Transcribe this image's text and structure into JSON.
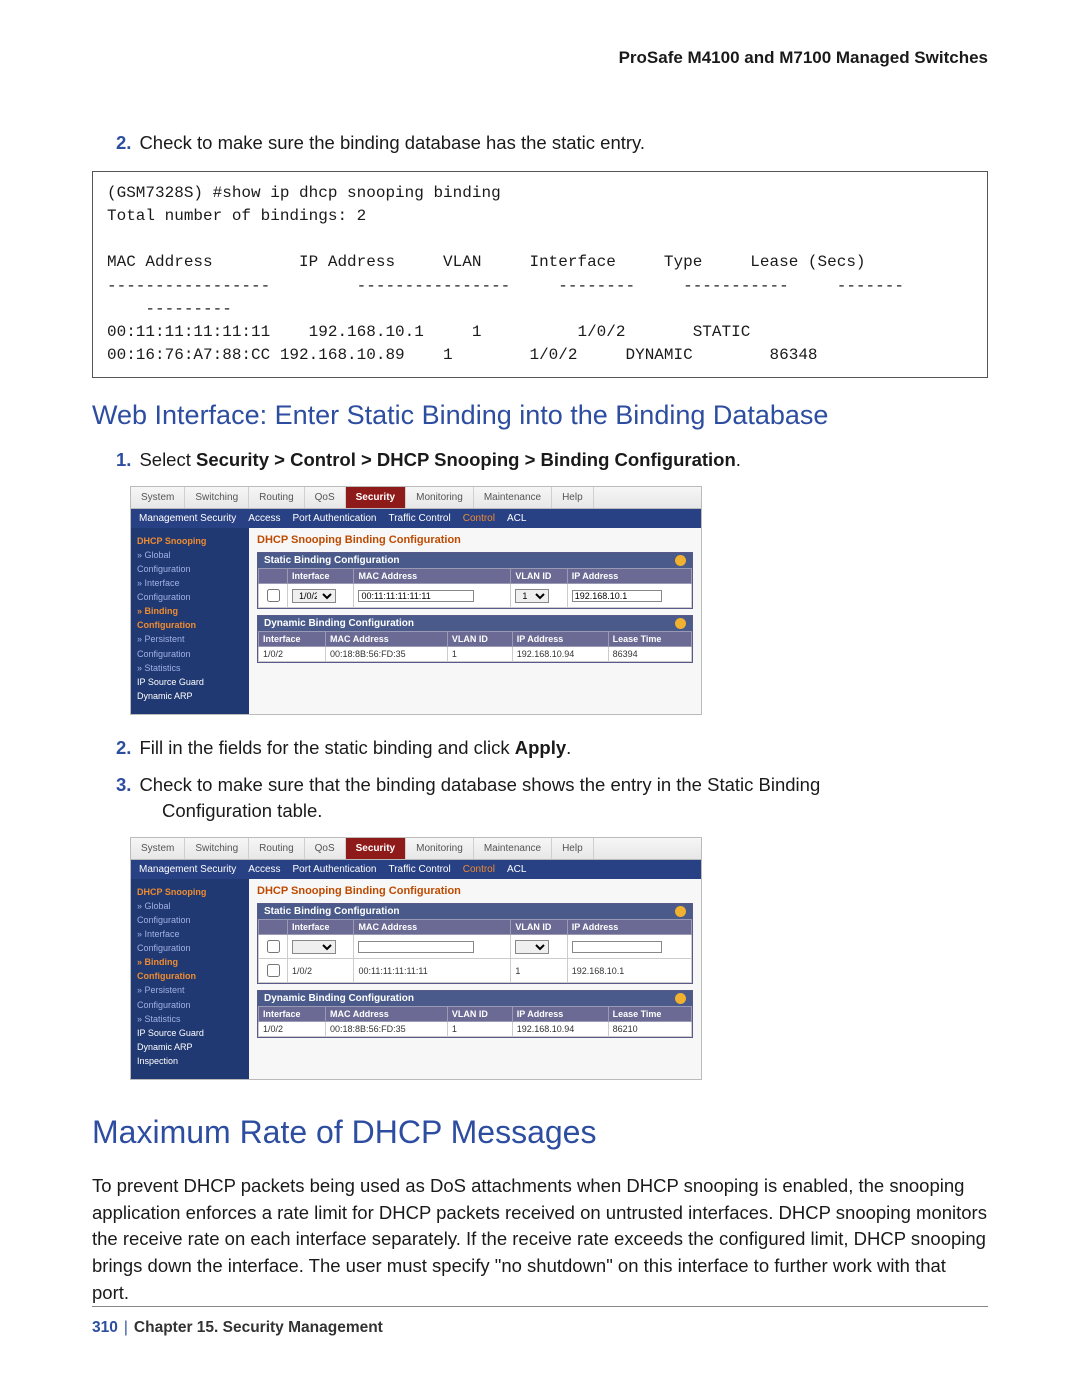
{
  "header": {
    "product_line": "ProSafe M4100 and M7100 Managed Switches"
  },
  "step2": {
    "num": "2.",
    "text": "Check to make sure the binding database has the static entry."
  },
  "code_block": "(GSM7328S) #show ip dhcp snooping binding\nTotal number of bindings: 2\n\nMAC Address         IP Address     VLAN     Interface     Type     Lease (Secs)\n-----------------         ----------------     --------     -----------     -------\n    ---------\n00:11:11:11:11:11    192.168.10.1     1          1/0/2       STATIC\n00:16:76:A7:88:CC 192.168.10.89    1        1/0/2     DYNAMIC        86348",
  "h3_web": "Web Interface: Enter Static Binding into the Binding Database",
  "step1b": {
    "num": "1.",
    "pre": "Select ",
    "bold": "Security > Control > DHCP Snooping > Binding Configuration",
    "post": "."
  },
  "ui": {
    "tabs": [
      "System",
      "Switching",
      "Routing",
      "QoS",
      "Security",
      "Monitoring",
      "Maintenance",
      "Help"
    ],
    "active_tab": "Security",
    "subnav": [
      "Management Security",
      "Access",
      "Port Authentication",
      "Traffic Control",
      "Control",
      "ACL"
    ],
    "subnav_active": "Control",
    "side1": {
      "items": [
        {
          "t": "DHCP Snooping",
          "cls": "hl"
        },
        {
          "t": "» Global",
          "cls": "dim"
        },
        {
          "t": "  Configuration",
          "cls": "dim"
        },
        {
          "t": "» Interface",
          "cls": "dim"
        },
        {
          "t": "  Configuration",
          "cls": "dim"
        },
        {
          "t": "» Binding",
          "cls": "hl"
        },
        {
          "t": "  Configuration",
          "cls": "hl"
        },
        {
          "t": "» Persistent",
          "cls": "dim"
        },
        {
          "t": "  Configuration",
          "cls": "dim"
        },
        {
          "t": "» Statistics",
          "cls": "dim"
        },
        {
          "t": "IP Source Guard",
          "cls": ""
        },
        {
          "t": "Dynamic ARP",
          "cls": ""
        }
      ]
    },
    "side2": {
      "items": [
        {
          "t": "DHCP Snooping",
          "cls": "hl"
        },
        {
          "t": "» Global",
          "cls": "dim"
        },
        {
          "t": "  Configuration",
          "cls": "dim"
        },
        {
          "t": "» Interface",
          "cls": "dim"
        },
        {
          "t": "  Configuration",
          "cls": "dim"
        },
        {
          "t": "» Binding",
          "cls": "hl"
        },
        {
          "t": "  Configuration",
          "cls": "hl"
        },
        {
          "t": "» Persistent",
          "cls": "dim"
        },
        {
          "t": "  Configuration",
          "cls": "dim"
        },
        {
          "t": "» Statistics",
          "cls": "dim"
        },
        {
          "t": "IP Source Guard",
          "cls": ""
        },
        {
          "t": "Dynamic ARP",
          "cls": ""
        },
        {
          "t": "Inspection",
          "cls": ""
        }
      ]
    },
    "main_title": "DHCP Snooping Binding Configuration",
    "sec_static": "Static Binding Configuration",
    "sec_dynamic": "Dynamic Binding Configuration",
    "static_headers": [
      "Interface",
      "MAC Address",
      "VLAN ID",
      "IP Address"
    ],
    "dynamic_headers": [
      "Interface",
      "MAC Address",
      "VLAN ID",
      "IP Address",
      "Lease Time"
    ],
    "shot1": {
      "static_row": {
        "interface": "1/0/2",
        "mac": "00:11:11:11:11:11",
        "vlan": "1",
        "ip": "192.168.10.1"
      },
      "dynamic_row": {
        "interface": "1/0/2",
        "mac": "00:18:8B:56:FD:35",
        "vlan": "1",
        "ip": "192.168.10.94",
        "lease": "86394"
      }
    },
    "shot2": {
      "static_edit_row": {
        "interface": "",
        "mac": "",
        "vlan": "",
        "ip": ""
      },
      "static_row": {
        "interface": "1/0/2",
        "mac": "00:11:11:11:11:11",
        "vlan": "1",
        "ip": "192.168.10.1"
      },
      "dynamic_row": {
        "interface": "1/0/2",
        "mac": "00:18:8B:56:FD:35",
        "vlan": "1",
        "ip": "192.168.10.94",
        "lease": "86210"
      }
    }
  },
  "step2b": {
    "num": "2.",
    "pre": "Fill in the fields for the static binding and click ",
    "bold": "Apply",
    "post": "."
  },
  "step3b": {
    "num": "3.",
    "text": "Check to make sure that the binding database shows the entry in the Static Binding",
    "cont": "Configuration table."
  },
  "h2_rate": "Maximum Rate of DHCP Messages",
  "rate_para": "To prevent DHCP packets being used as DoS attachments when DHCP snooping is enabled, the snooping application enforces a rate limit for DHCP packets received on untrusted interfaces. DHCP snooping monitors the receive rate on each interface separately. If the receive rate exceeds the configured limit, DHCP snooping brings down the interface. The user must specify \"no shutdown\" on this interface to further work with that port.",
  "footer": {
    "page": "310",
    "chapter": "Chapter 15.  Security Management"
  }
}
